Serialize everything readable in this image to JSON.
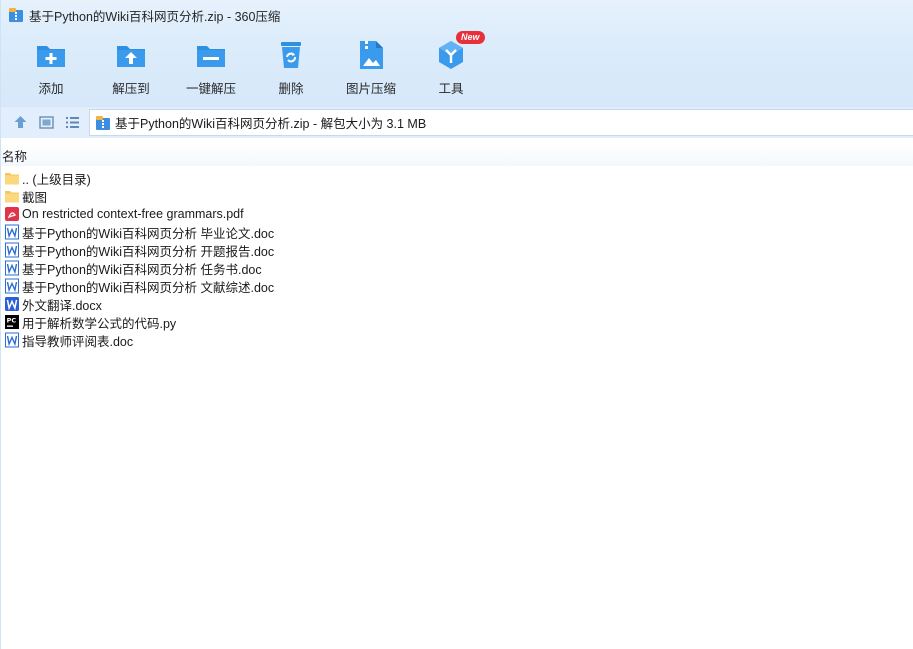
{
  "window": {
    "title": "基于Python的Wiki百科网页分析.zip - 360压缩"
  },
  "toolbar": {
    "items": [
      {
        "label": "添加",
        "icon": "folder-add-icon"
      },
      {
        "label": "解压到",
        "icon": "folder-extract-icon"
      },
      {
        "label": "一键解压",
        "icon": "folder-one-click-extract-icon"
      },
      {
        "label": "删除",
        "icon": "recycle-bin-icon"
      },
      {
        "label": "图片压缩",
        "icon": "image-compress-icon"
      },
      {
        "label": "工具",
        "icon": "tools-cube-icon",
        "badge": "New"
      }
    ]
  },
  "addressbar": {
    "path": "基于Python的Wiki百科网页分析.zip - 解包大小为 3.1 MB"
  },
  "list": {
    "column_name": "名称",
    "files": [
      {
        "name": ".. (上级目录)",
        "type": "folder"
      },
      {
        "name": "截图",
        "type": "folder"
      },
      {
        "name": "On restricted context-free grammars.pdf",
        "type": "pdf"
      },
      {
        "name": "基于Python的Wiki百科网页分析 毕业论文.doc",
        "type": "doc"
      },
      {
        "name": "基于Python的Wiki百科网页分析 开题报告.doc",
        "type": "doc"
      },
      {
        "name": "基于Python的Wiki百科网页分析 任务书.doc",
        "type": "doc"
      },
      {
        "name": "基于Python的Wiki百科网页分析 文献综述.doc",
        "type": "doc"
      },
      {
        "name": "外文翻译.docx",
        "type": "docx"
      },
      {
        "name": "用于解析数学公式的代码.py",
        "type": "py"
      },
      {
        "name": "指导教师评阅表.doc",
        "type": "doc"
      }
    ]
  },
  "colors": {
    "accent": "#2f8fe0",
    "badge": "#e8303a"
  }
}
